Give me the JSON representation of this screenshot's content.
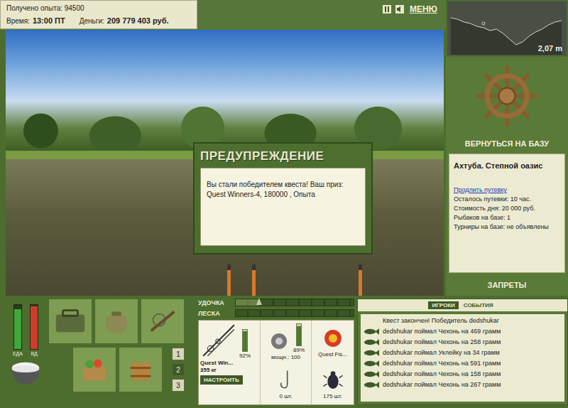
{
  "header": {
    "experience": "Получено опыта: 94500",
    "time_label": "Время:",
    "time": "13:00 ПТ",
    "money_label": "Деньги:",
    "money": "209 779 403 руб."
  },
  "toolbar": {
    "menu": "МЕНЮ"
  },
  "depth_map": {
    "reading": "2,07 m",
    "profile": [
      0.6,
      0.7,
      0.9,
      1.0,
      1.2,
      1.3,
      1.5,
      1.4,
      1.7,
      2.1,
      2.5,
      2.3,
      1.9,
      1.6,
      1.4,
      1.1,
      0.9,
      0.8
    ],
    "cast_point": 5
  },
  "dialog": {
    "title": "ПРЕДУПРЕЖДЕНИЕ",
    "message": "Вы стали победителем квеста! Ваш приз: Quest Winners-4, 180000 , Опыта"
  },
  "side_panel": {
    "return_button": "ВЕРНУТЬСЯ НА БАЗУ",
    "location": "Ахтуба. Степной оазис",
    "extend_link": "Продлить путевку",
    "lines": [
      "Осталось путевки: 10 час.",
      "Стоимость дня: 20 000 руб.",
      "Рыбаков на базе: 1",
      "Турниры на базе: не объявлены"
    ],
    "bans_button": "ЗАПРЕТЫ"
  },
  "meters": [
    {
      "label": "ЕДА",
      "level": 0.9,
      "color": "#3fa83a"
    },
    {
      "label": "ВД",
      "level": 0.97,
      "color": "#d23a2a"
    }
  ],
  "slots": [
    {
      "label": "1",
      "selected": false
    },
    {
      "label": "2",
      "selected": true
    },
    {
      "label": "3",
      "selected": false
    }
  ],
  "tension": [
    {
      "label": "УДОЧКА",
      "level": 0.2
    },
    {
      "label": "ЛЕСКА",
      "level": 0
    }
  ],
  "tackle": {
    "rod": {
      "name": "Quest Win...",
      "load": "355 кг",
      "level": 0.92,
      "reading": "92%"
    },
    "configure_button": "НАСТРОИТЬ",
    "reel": {
      "power": "мощн.: 100",
      "level": 0.89,
      "reading": "89%"
    },
    "lure": {
      "name": "Quest Fis..."
    },
    "hook": {
      "count": "0 шт."
    },
    "bait": {
      "count": "175 шт."
    }
  },
  "log": {
    "tabs": [
      {
        "label": "ИГРОКИ",
        "selected": true
      },
      {
        "label": "СОБЫТИЯ",
        "selected": false
      }
    ],
    "entries": [
      {
        "kind": "notice",
        "text": "Квест закончен! Победитель dedshukar"
      },
      {
        "kind": "catch",
        "text": "dedshukar поймал Чехонь на 469 грамм"
      },
      {
        "kind": "catch",
        "text": "dedshukar поймал Чехонь на 258 грамм"
      },
      {
        "kind": "catch",
        "text": "dedshukar поймал Уклейку на 34 грамм"
      },
      {
        "kind": "catch",
        "text": "dedshukar поймал Чехонь на 591 грамм"
      },
      {
        "kind": "catch",
        "text": "dedshukar поймал Чехонь на 158 грамм"
      },
      {
        "kind": "catch",
        "text": "dedshukar поймал Чехонь на 267 грамм"
      }
    ]
  }
}
